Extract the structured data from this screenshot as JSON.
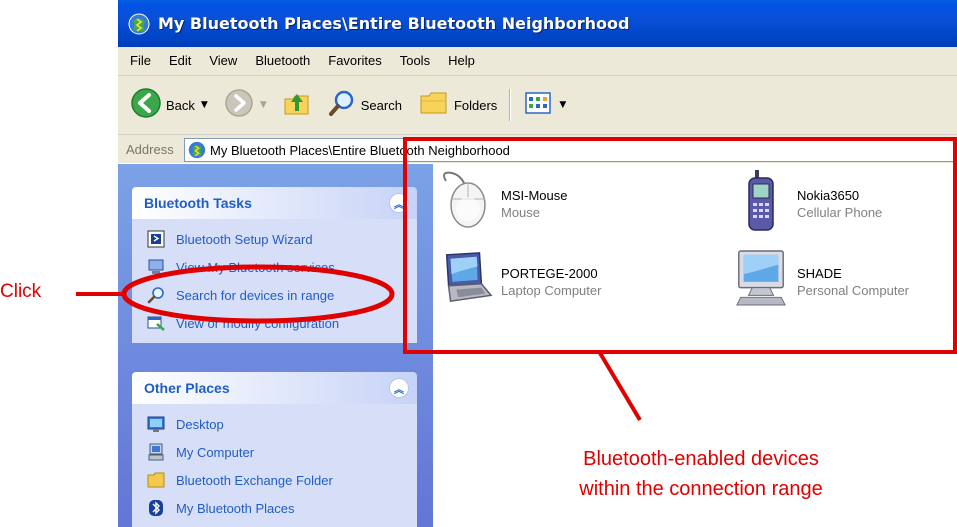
{
  "window": {
    "title": "My Bluetooth Places\\Entire Bluetooth Neighborhood"
  },
  "menu": [
    "File",
    "Edit",
    "View",
    "Bluetooth",
    "Favorites",
    "Tools",
    "Help"
  ],
  "toolbar": {
    "back_label": "Back",
    "search_label": "Search",
    "folders_label": "Folders"
  },
  "address": {
    "label": "Address",
    "value": "My Bluetooth Places\\Entire Bluetooth Neighborhood"
  },
  "task_panels": {
    "bluetooth_tasks": {
      "title": "Bluetooth Tasks",
      "items": [
        {
          "label": "Bluetooth Setup Wizard",
          "icon": "setup-wizard-icon"
        },
        {
          "label": "View My Bluetooth services",
          "icon": "bluetooth-services-icon"
        },
        {
          "label": "Search for devices in range",
          "icon": "magnifier-icon"
        },
        {
          "label": "View or modify configuration",
          "icon": "configuration-icon"
        }
      ]
    },
    "other_places": {
      "title": "Other Places",
      "items": [
        {
          "label": "Desktop",
          "icon": "desktop-icon"
        },
        {
          "label": "My Computer",
          "icon": "my-computer-icon"
        },
        {
          "label": "Bluetooth Exchange Folder",
          "icon": "folder-icon"
        },
        {
          "label": "My Bluetooth Places",
          "icon": "bluetooth-icon"
        }
      ]
    }
  },
  "devices": [
    {
      "name": "MSI-Mouse",
      "type": "Mouse",
      "icon": "mouse-icon"
    },
    {
      "name": "Nokia3650",
      "type": "Cellular Phone",
      "icon": "cellphone-icon"
    },
    {
      "name": "PORTEGE-2000",
      "type": "Laptop Computer",
      "icon": "laptop-icon"
    },
    {
      "name": "SHADE",
      "type": "Personal Computer",
      "icon": "desktop-computer-icon"
    }
  ],
  "annotations": {
    "click_label": "Click",
    "caption_line1": "Bluetooth-enabled devices",
    "caption_line2": "within the connection range",
    "color": "#e00000"
  },
  "colors": {
    "titlebar": "#0054e3",
    "taskpane": "#7ba2e7",
    "task_link": "#215dc6",
    "chrome": "#ece9d8"
  }
}
